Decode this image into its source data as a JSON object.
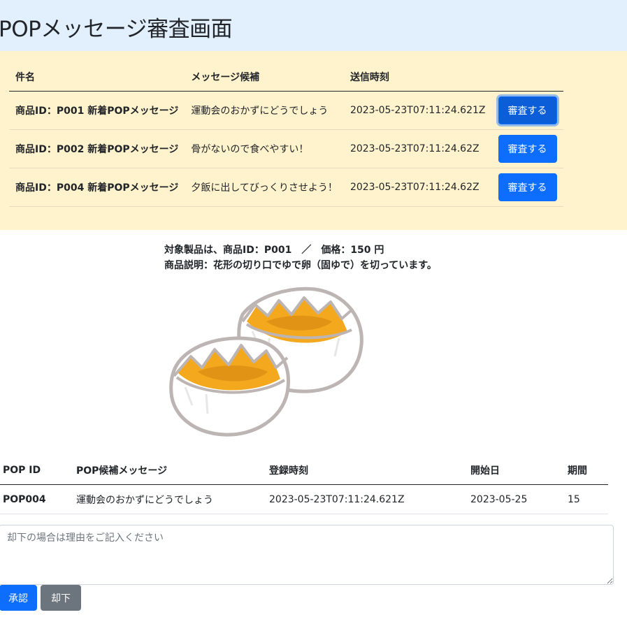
{
  "header": {
    "title": "POPメッセージ審査画面"
  },
  "queue": {
    "columns": [
      "件名",
      "メッセージ候補",
      "送信時刻"
    ],
    "rows": [
      {
        "subject": "商品ID：P001 新着POPメッセージ",
        "message": "運動会のおかずにどうでしょう",
        "sent_at": "2023-05-23T07:11:24.621Z",
        "action": "審査する"
      },
      {
        "subject": "商品ID：P002 新着POPメッセージ",
        "message": "骨がないので食べやすい！",
        "sent_at": "2023-05-23T07:11:24.62Z",
        "action": "審査する"
      },
      {
        "subject": "商品ID：P004 新着POPメッセージ",
        "message": "夕飯に出してびっくりさせよう！",
        "sent_at": "2023-05-23T07:11:24.62Z",
        "action": "審査する"
      }
    ]
  },
  "product": {
    "summary": "対象製品は、商品ID：P001　／　価格：150 円",
    "description": "商品説明：花形の切り口でゆで卵（固ゆで）を切っています。",
    "image_icon": "boiled-egg-illustration"
  },
  "pop_table": {
    "columns": [
      "POP ID",
      "POP候補メッセージ",
      "登録時刻",
      "開始日",
      "期間"
    ],
    "rows": [
      {
        "id": "POP004",
        "message": "運動会のおかずにどうでしょう",
        "registered_at": "2023-05-23T07:11:24.621Z",
        "start_date": "2023-05-25",
        "period": "15"
      }
    ]
  },
  "review": {
    "placeholder": "却下の場合は理由をご記入ください",
    "approve_label": "承認",
    "reject_label": "却下"
  },
  "colors": {
    "header_bg": "#e2f0fd",
    "queue_bg": "#fff3cd",
    "primary": "#0d6efd",
    "secondary": "#6c757d"
  }
}
